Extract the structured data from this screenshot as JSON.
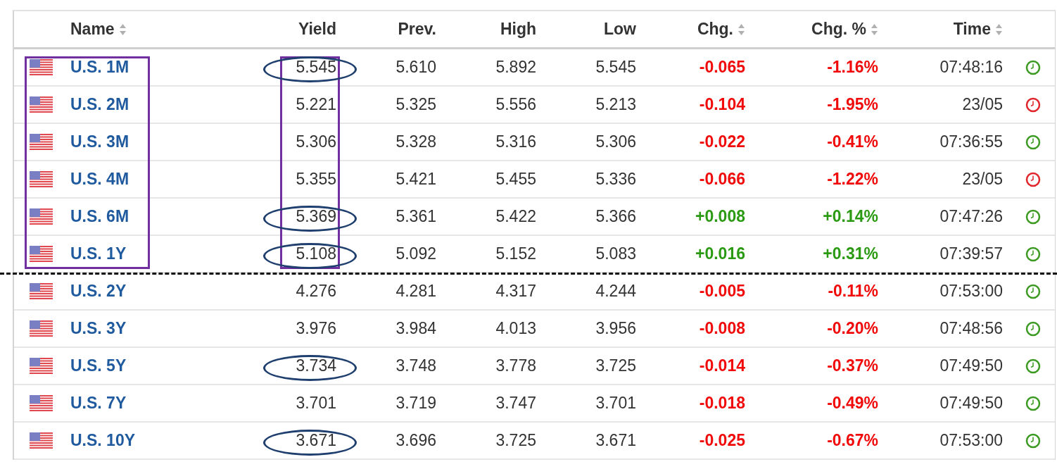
{
  "columns": [
    {
      "label": "Name",
      "sortable": true
    },
    {
      "label": "Yield",
      "sortable": false
    },
    {
      "label": "Prev.",
      "sortable": false
    },
    {
      "label": "High",
      "sortable": false
    },
    {
      "label": "Low",
      "sortable": false
    },
    {
      "label": "Chg.",
      "sortable": true
    },
    {
      "label": "Chg. %",
      "sortable": true
    },
    {
      "label": "Time",
      "sortable": true
    }
  ],
  "rows": [
    {
      "name": "U.S. 1M",
      "yield": "5.545",
      "prev": "5.610",
      "high": "5.892",
      "low": "5.545",
      "chg": "-0.065",
      "chg_pct": "-1.16%",
      "time": "07:48:16",
      "kind": "loss",
      "color": "#3c9a22",
      "boxed": true,
      "circled": true,
      "dashed_line_below": false
    },
    {
      "name": "U.S. 2M",
      "yield": "5.221",
      "prev": "5.325",
      "high": "5.556",
      "low": "5.213",
      "chg": "-0.104",
      "chg_pct": "-1.95%",
      "time": "23/05",
      "kind": "loss",
      "color": "#e0262c",
      "boxed": true,
      "circled": false,
      "dashed_line_below": false
    },
    {
      "name": "U.S. 3M",
      "yield": "5.306",
      "prev": "5.328",
      "high": "5.316",
      "low": "5.306",
      "chg": "-0.022",
      "chg_pct": "-0.41%",
      "time": "07:36:55",
      "kind": "loss",
      "color": "#3c9a22",
      "boxed": true,
      "circled": false,
      "dashed_line_below": false
    },
    {
      "name": "U.S. 4M",
      "yield": "5.355",
      "prev": "5.421",
      "high": "5.455",
      "low": "5.336",
      "chg": "-0.066",
      "chg_pct": "-1.22%",
      "time": "23/05",
      "kind": "loss",
      "color": "#e0262c",
      "boxed": true,
      "circled": false,
      "dashed_line_below": false
    },
    {
      "name": "U.S. 6M",
      "yield": "5.369",
      "prev": "5.361",
      "high": "5.422",
      "low": "5.366",
      "chg": "+0.008",
      "chg_pct": "+0.14%",
      "time": "07:47:26",
      "kind": "gain",
      "color": "#3c9a22",
      "boxed": true,
      "circled": true,
      "dashed_line_below": false
    },
    {
      "name": "U.S. 1Y",
      "yield": "5.108",
      "prev": "5.092",
      "high": "5.152",
      "low": "5.083",
      "chg": "+0.016",
      "chg_pct": "+0.31%",
      "time": "07:39:57",
      "kind": "gain",
      "color": "#3c9a22",
      "boxed": true,
      "circled": true,
      "dashed_line_below": true
    },
    {
      "name": "U.S. 2Y",
      "yield": "4.276",
      "prev": "4.281",
      "high": "4.317",
      "low": "4.244",
      "chg": "-0.005",
      "chg_pct": "-0.11%",
      "time": "07:53:00",
      "kind": "loss",
      "color": "#3c9a22",
      "boxed": false,
      "circled": false,
      "dashed_line_below": false
    },
    {
      "name": "U.S. 3Y",
      "yield": "3.976",
      "prev": "3.984",
      "high": "4.013",
      "low": "3.956",
      "chg": "-0.008",
      "chg_pct": "-0.20%",
      "time": "07:48:56",
      "kind": "loss",
      "color": "#3c9a22",
      "boxed": false,
      "circled": false,
      "dashed_line_below": false
    },
    {
      "name": "U.S. 5Y",
      "yield": "3.734",
      "prev": "3.748",
      "high": "3.778",
      "low": "3.725",
      "chg": "-0.014",
      "chg_pct": "-0.37%",
      "time": "07:49:50",
      "kind": "loss",
      "color": "#3c9a22",
      "boxed": false,
      "circled": true,
      "dashed_line_below": false
    },
    {
      "name": "U.S. 7Y",
      "yield": "3.701",
      "prev": "3.719",
      "high": "3.747",
      "low": "3.701",
      "chg": "-0.018",
      "chg_pct": "-0.49%",
      "time": "07:49:50",
      "kind": "loss",
      "color": "#3c9a22",
      "boxed": false,
      "circled": false,
      "dashed_line_below": false
    },
    {
      "name": "U.S. 10Y",
      "yield": "3.671",
      "prev": "3.696",
      "high": "3.725",
      "low": "3.671",
      "chg": "-0.025",
      "chg_pct": "-0.67%",
      "time": "07:53:00",
      "kind": "loss",
      "color": "#3c9a22",
      "boxed": false,
      "circled": true,
      "dashed_line_below": false
    }
  ]
}
